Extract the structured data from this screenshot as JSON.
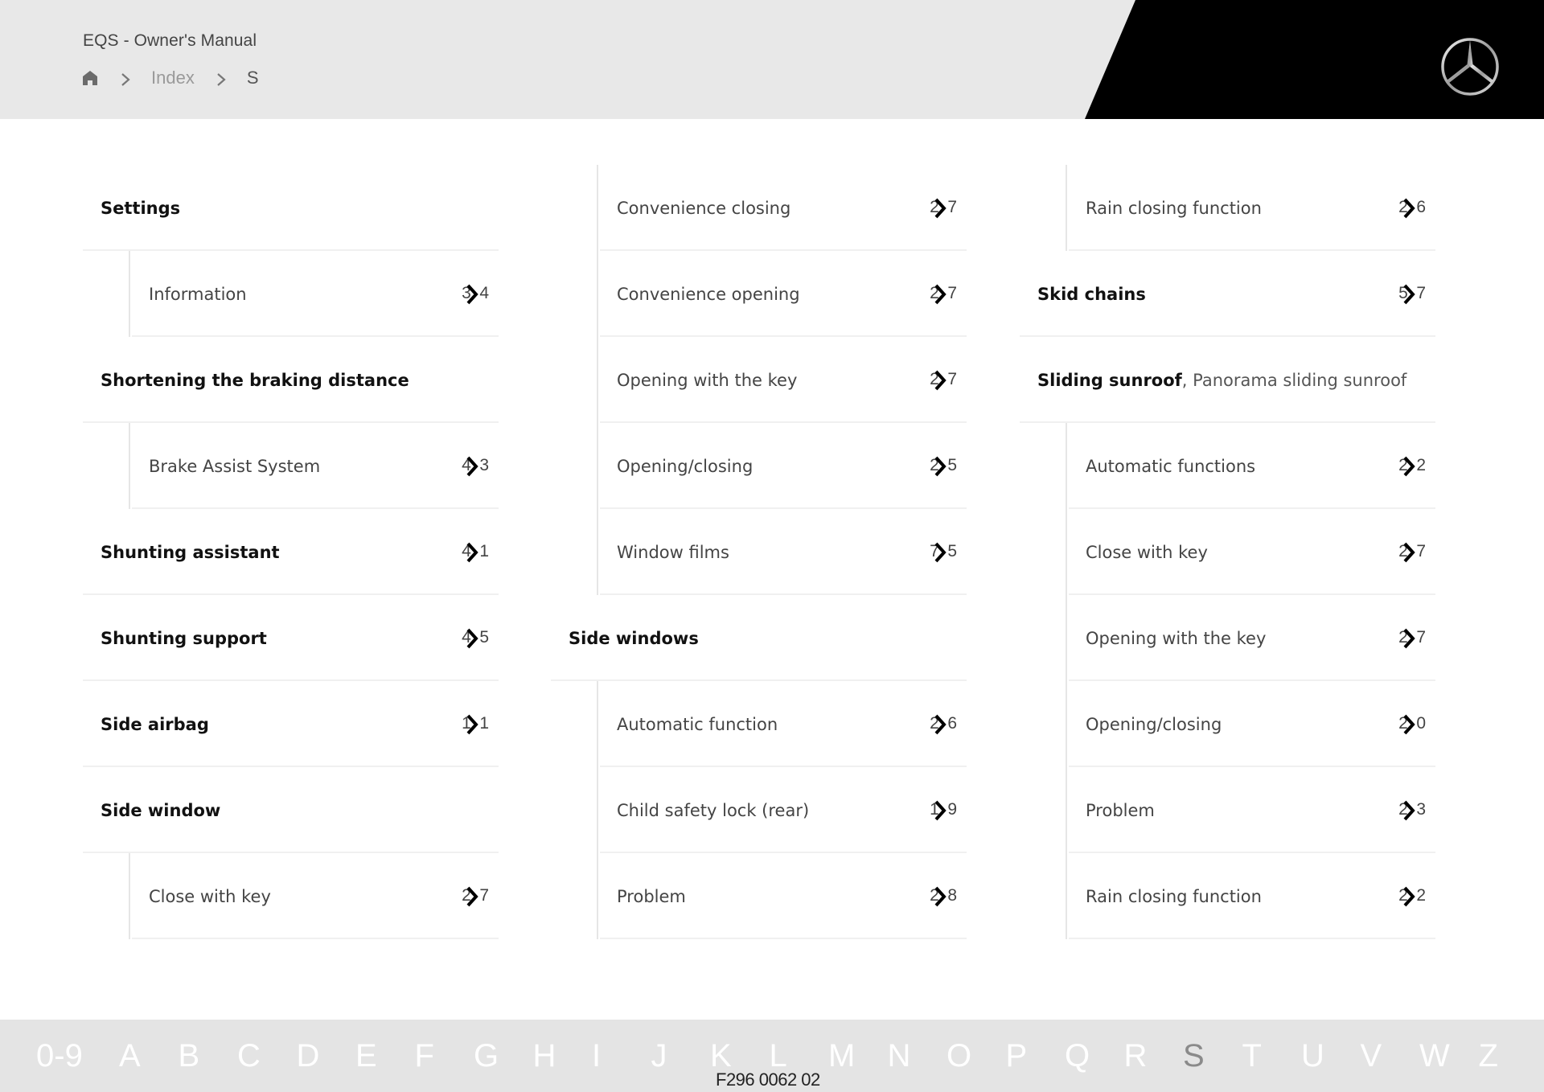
{
  "header": {
    "app_title": "EQS - Owner's Manual",
    "breadcrumb": {
      "home_icon": "home-icon",
      "separator_icon": "chevron-right-icon",
      "items": [
        "Index",
        "S"
      ]
    },
    "logo": "mercedes-star-logo"
  },
  "colors": {
    "header_bg": "#e8e8e8",
    "header_black": "#000000",
    "alpha_bar_bg": "#e4e4e4",
    "alpha_inactive": "#ffffff",
    "alpha_active": "#8a8a8a"
  },
  "index": {
    "columns": [
      {
        "rows": [
          {
            "type": "parent",
            "label": "Settings",
            "page": ""
          },
          {
            "type": "child",
            "label": "Information",
            "page": "3›4"
          },
          {
            "type": "parent",
            "label": "Shortening the braking distance",
            "page": ""
          },
          {
            "type": "child",
            "label": "Brake Assist System",
            "page": "4›3"
          },
          {
            "type": "parent",
            "label": "Shunting assistant",
            "page": "4›1"
          },
          {
            "type": "parent",
            "label": "Shunting support",
            "page": "4›5"
          },
          {
            "type": "parent",
            "label": "Side airbag",
            "page": "1›1"
          },
          {
            "type": "parent",
            "label": "Side window",
            "page": ""
          },
          {
            "type": "child",
            "label": "Close with key",
            "page": "2›7"
          }
        ]
      },
      {
        "rows": [
          {
            "type": "child",
            "label": "Convenience closing",
            "page": "2›7"
          },
          {
            "type": "child",
            "label": "Convenience opening",
            "page": "2›7"
          },
          {
            "type": "child",
            "label": "Opening with the key",
            "page": "2›7"
          },
          {
            "type": "child",
            "label": "Opening/closing",
            "page": "2›5"
          },
          {
            "type": "child",
            "label": "Window films",
            "page": "7›5"
          },
          {
            "type": "parent",
            "label": "Side windows",
            "page": ""
          },
          {
            "type": "child",
            "label": "Automatic function",
            "page": "2›6"
          },
          {
            "type": "child",
            "label": "Child safety lock (rear)",
            "page": "1›9"
          },
          {
            "type": "child",
            "label": "Problem",
            "page": "2›8"
          }
        ]
      },
      {
        "rows": [
          {
            "type": "child",
            "label": "Rain closing function",
            "page": "2›6"
          },
          {
            "type": "parent",
            "label": "Skid chains",
            "page": "5›7"
          },
          {
            "type": "parent",
            "label": "Sliding sunroof",
            "sub": ", Panorama sliding sunroof",
            "page": ""
          },
          {
            "type": "child",
            "label": "Automatic functions",
            "page": "2›2"
          },
          {
            "type": "child",
            "label": "Close with key",
            "page": "2›7"
          },
          {
            "type": "child",
            "label": "Opening with the key",
            "page": "2›7"
          },
          {
            "type": "child",
            "label": "Opening/closing",
            "page": "2›0"
          },
          {
            "type": "child",
            "label": "Problem",
            "page": "2›3"
          },
          {
            "type": "child",
            "label": "Rain closing function",
            "page": "2›2"
          }
        ]
      }
    ]
  },
  "alphabet": {
    "items": [
      "0-9",
      "A",
      "B",
      "C",
      "D",
      "E",
      "F",
      "G",
      "H",
      "I",
      "J",
      "K",
      "L",
      "M",
      "N",
      "O",
      "P",
      "Q",
      "R",
      "S",
      "T",
      "U",
      "V",
      "W",
      "Z"
    ],
    "active": "S"
  },
  "footer": {
    "doc_code": "F296 0062 02"
  }
}
